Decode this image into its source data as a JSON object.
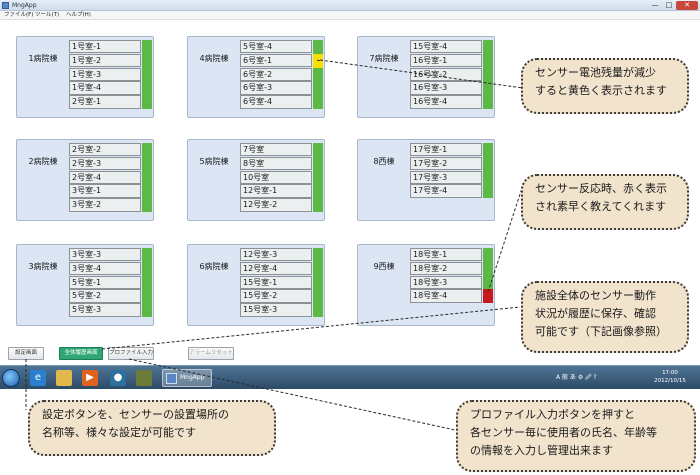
{
  "window": {
    "title": "MngApp",
    "controls": {
      "minimize": "—",
      "maximize": "□",
      "close": "✕"
    }
  },
  "menu": [
    "ファイル(F)",
    "ツール(T)",
    "ヘルプ(H)"
  ],
  "colors": {
    "normal": "#5cb946",
    "low_battery": "#f7e000",
    "alert": "#c8191f",
    "panel": "#dbe5f4"
  },
  "wards": [
    {
      "name": "1病院棟",
      "rooms": [
        "1号室-1",
        "1号室-2",
        "1号室-3",
        "1号室-4",
        "2号室-1"
      ],
      "statuses": [
        "normal",
        "normal",
        "normal",
        "normal",
        "normal"
      ]
    },
    {
      "name": "4病院棟",
      "rooms": [
        "5号室-4",
        "6号室-1",
        "6号室-2",
        "6号室-3",
        "6号室-4"
      ],
      "statuses": [
        "normal",
        "low_battery",
        "normal",
        "normal",
        "normal"
      ]
    },
    {
      "name": "7病院棟",
      "rooms": [
        "15号室-4",
        "16号室-1",
        "16号室-2",
        "16号室-3",
        "16号室-4"
      ],
      "statuses": [
        "normal",
        "normal",
        "normal",
        "normal",
        "normal"
      ]
    },
    {
      "name": "2病院棟",
      "rooms": [
        "2号室-2",
        "2号室-3",
        "2号室-4",
        "3号室-1",
        "3号室-2"
      ],
      "statuses": [
        "normal",
        "normal",
        "normal",
        "normal",
        "normal"
      ]
    },
    {
      "name": "5病院棟",
      "rooms": [
        "7号室",
        "8号室",
        "10号室",
        "12号室-1",
        "12号室-2"
      ],
      "statuses": [
        "normal",
        "normal",
        "normal",
        "normal",
        "normal"
      ]
    },
    {
      "name": "8西棟",
      "rooms": [
        "17号室-1",
        "17号室-2",
        "17号室-3",
        "17号室-4"
      ],
      "statuses": [
        "normal",
        "normal",
        "normal",
        "normal"
      ]
    },
    {
      "name": "3病院棟",
      "rooms": [
        "3号室-3",
        "3号室-4",
        "5号室-1",
        "5号室-2",
        "5号室-3"
      ],
      "statuses": [
        "normal",
        "normal",
        "normal",
        "normal",
        "normal"
      ]
    },
    {
      "name": "6病院棟",
      "rooms": [
        "12号室-3",
        "12号室-4",
        "15号室-1",
        "15号室-2",
        "15号室-3"
      ],
      "statuses": [
        "normal",
        "normal",
        "normal",
        "normal",
        "normal"
      ]
    },
    {
      "name": "9西棟",
      "rooms": [
        "18号室-1",
        "18号室-2",
        "18号室-3",
        "18号室-4"
      ],
      "statuses": [
        "normal",
        "normal",
        "normal",
        "alert"
      ]
    }
  ],
  "buttons": {
    "settings": "設定画面",
    "overview": "全体履歴画面",
    "profile": "プロファイル入力",
    "alarm_reset": "アラームリセット"
  },
  "taskbar": {
    "app_task": "MngApp",
    "clock_time": "17:00",
    "clock_date": "2012/10/15",
    "tray_text": "A 般 あ ⚙ 🖉 ?"
  },
  "callouts": {
    "battery": [
      "センサー電池残量が減少",
      "すると黄色く表示されます"
    ],
    "reaction": [
      "センサー反応時、赤く表示",
      "され素早く教えてくれます"
    ],
    "history": [
      "施設全体のセンサー動作",
      "状況が履歴に保存、確認",
      "可能です（下記画像参照）"
    ],
    "settings": [
      "設定ボタンを、センサーの設置場所の",
      "名称等、様々な設定が可能です"
    ],
    "profile": [
      "プロファイル入力ボタンを押すと",
      "各センサー毎に使用者の氏名、年齢等",
      "の情報を入力し管理出来ます"
    ]
  }
}
